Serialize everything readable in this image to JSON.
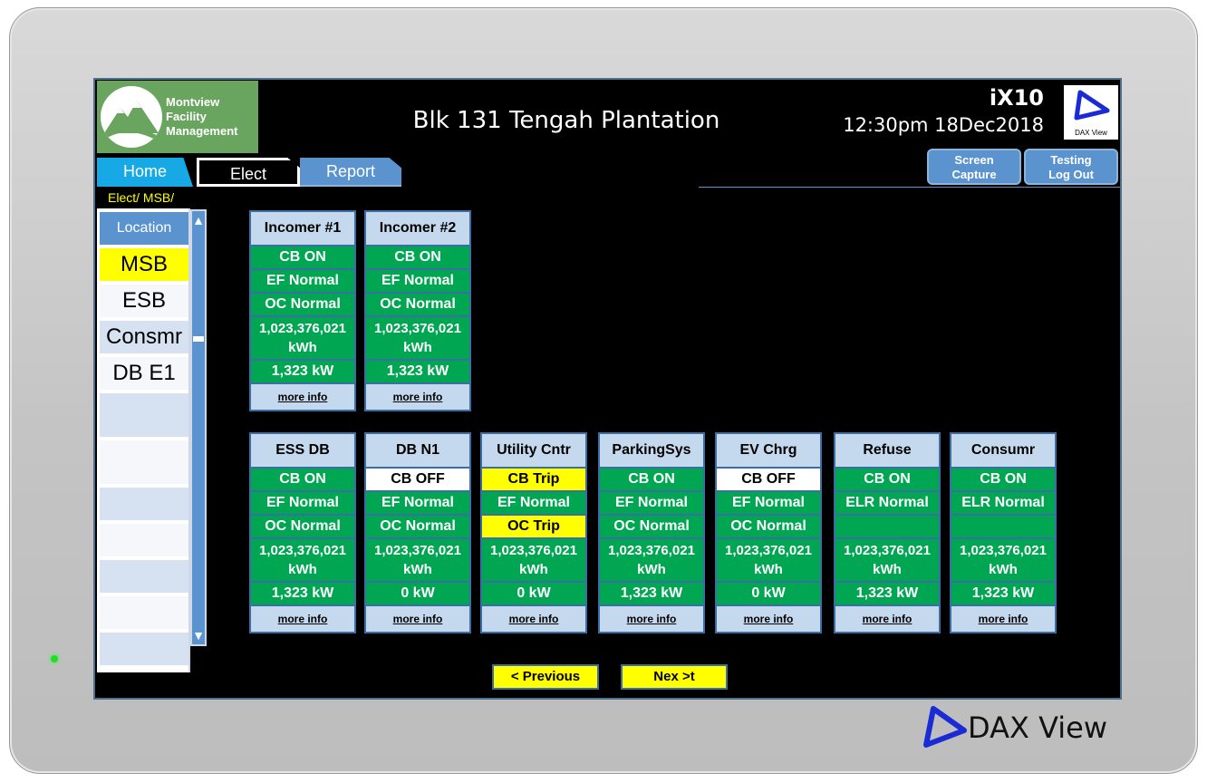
{
  "header": {
    "logo_lines": [
      "Montview",
      "Facility",
      "Management"
    ],
    "title": "Blk 131 Tengah Plantation",
    "model": "iX10",
    "datetime": "12:30pm 18Dec2018",
    "dax_label": "DAX View"
  },
  "tabs": [
    {
      "label": "Home"
    },
    {
      "label": "Elect"
    },
    {
      "label": "Report"
    }
  ],
  "buttons": {
    "screen_capture": [
      "Screen",
      "Capture"
    ],
    "logout": [
      "Testing",
      "Log Out"
    ]
  },
  "breadcrumb": "Elect/ MSB/",
  "sidebar": {
    "header": "Location",
    "items": [
      "MSB",
      "ESB",
      "Consmr",
      "DB E1"
    ],
    "selected": "MSB"
  },
  "scroll": {
    "up": "▲",
    "down": "▼"
  },
  "feeders": [
    {
      "name": "Incomer #1",
      "cb": "CB ON",
      "cb_state": "green",
      "ef": "EF Normal",
      "oc": "OC Normal",
      "oc_state": "green",
      "energy_value": "1,023,376,021",
      "energy_unit": "kWh",
      "power": "1,323 kW",
      "more": "more info"
    },
    {
      "name": "Incomer #2",
      "cb": "CB ON",
      "cb_state": "green",
      "ef": "EF Normal",
      "oc": "OC Normal",
      "oc_state": "green",
      "energy_value": "1,023,376,021",
      "energy_unit": "kWh",
      "power": "1,323 kW",
      "more": "more info"
    },
    {
      "name": "ESS DB",
      "cb": "CB ON",
      "cb_state": "green",
      "ef": "EF Normal",
      "oc": "OC Normal",
      "oc_state": "green",
      "energy_value": "1,023,376,021",
      "energy_unit": "kWh",
      "power": "1,323 kW",
      "more": "more info"
    },
    {
      "name": "DB N1",
      "cb": "CB OFF",
      "cb_state": "white",
      "ef": "EF Normal",
      "oc": "OC Normal",
      "oc_state": "green",
      "energy_value": "1,023,376,021",
      "energy_unit": "kWh",
      "power": "0 kW",
      "more": "more info"
    },
    {
      "name": "Utility Cntr",
      "cb": "CB Trip",
      "cb_state": "yellow",
      "ef": "EF Normal",
      "oc": "OC Trip",
      "oc_state": "yellow",
      "energy_value": "1,023,376,021",
      "energy_unit": "kWh",
      "power": "0 kW",
      "more": "more info"
    },
    {
      "name": "ParkingSys",
      "cb": "CB ON",
      "cb_state": "green",
      "ef": "EF Normal",
      "oc": "OC Normal",
      "oc_state": "green",
      "energy_value": "1,023,376,021",
      "energy_unit": "kWh",
      "power": "1,323 kW",
      "more": "more info"
    },
    {
      "name": "EV Chrg",
      "cb": "CB OFF",
      "cb_state": "white",
      "ef": "EF Normal",
      "oc": "OC Normal",
      "oc_state": "green",
      "energy_value": "1,023,376,021",
      "energy_unit": "kWh",
      "power": "0 kW",
      "more": "more info"
    },
    {
      "name": "Refuse",
      "cb": "CB ON",
      "cb_state": "green",
      "ef": "ELR Normal",
      "oc": "",
      "oc_state": "green",
      "energy_value": "1,023,376,021",
      "energy_unit": "kWh",
      "power": "1,323 kW",
      "more": "more info"
    },
    {
      "name": "Consumr",
      "cb": "CB ON",
      "cb_state": "green",
      "ef": "ELR Normal",
      "oc": "",
      "oc_state": "green",
      "energy_value": "1,023,376,021",
      "energy_unit": "kWh",
      "power": "1,323 kW",
      "more": "more info"
    }
  ],
  "nav": {
    "previous": "< Previous",
    "next": "Nex >t"
  },
  "brand": "DAX View",
  "colors": {
    "ok": "#00a651",
    "off": "#ffffff",
    "trip": "#ffff00",
    "accent": "#5b93cf",
    "home_tab": "#16a9e6"
  }
}
